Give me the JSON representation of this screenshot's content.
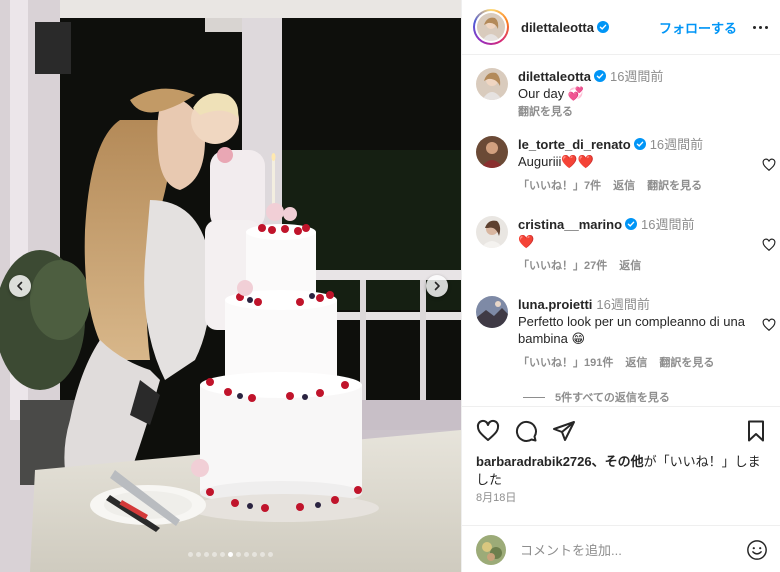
{
  "post": {
    "author": "dilettaleotta",
    "follow_label": "フォローする",
    "date": "8月18日",
    "likes_user": "barbaradrabik2726",
    "likes_suffix_1": "、その他",
    "likes_suffix_2": "が「いいね！」しました",
    "carousel_total": 11,
    "carousel_active": 5
  },
  "caption": {
    "username": "dilettaleotta",
    "time": "16週間前",
    "text": "Our day 💞",
    "translate": "翻訳を見る"
  },
  "comments": [
    {
      "username": "le_torte_di_renato",
      "verified": true,
      "time": "16週間前",
      "text": "Auguriii❤️❤️",
      "like_label": "「いいね！」7件",
      "reply_label": "返信",
      "translate_label": "翻訳を見る"
    },
    {
      "username": "cristina__marino",
      "verified": true,
      "time": "16週間前",
      "text": "❤️",
      "like_label": "「いいね！」27件",
      "reply_label": "返信",
      "translate_label": ""
    },
    {
      "username": "luna.proietti",
      "verified": false,
      "time": "16週間前",
      "text": "Perfetto look per un compleanno di una bambina 😁",
      "like_label": "「いいね！」191件",
      "reply_label": "返信",
      "translate_label": "翻訳を見る"
    }
  ],
  "view_replies": "5件すべての返信を見る",
  "add_comment": {
    "placeholder": "コメントを追加..."
  },
  "icons": {
    "like": "heart-icon",
    "comment": "comment-bubble-icon",
    "share": "paper-plane-icon",
    "save": "bookmark-icon",
    "emoji": "smiley-icon",
    "more": "more-dots-icon"
  },
  "colors": {
    "link_blue": "#0095f6",
    "verified_blue": "#0095f6",
    "muted_text": "#8e8e8e"
  }
}
